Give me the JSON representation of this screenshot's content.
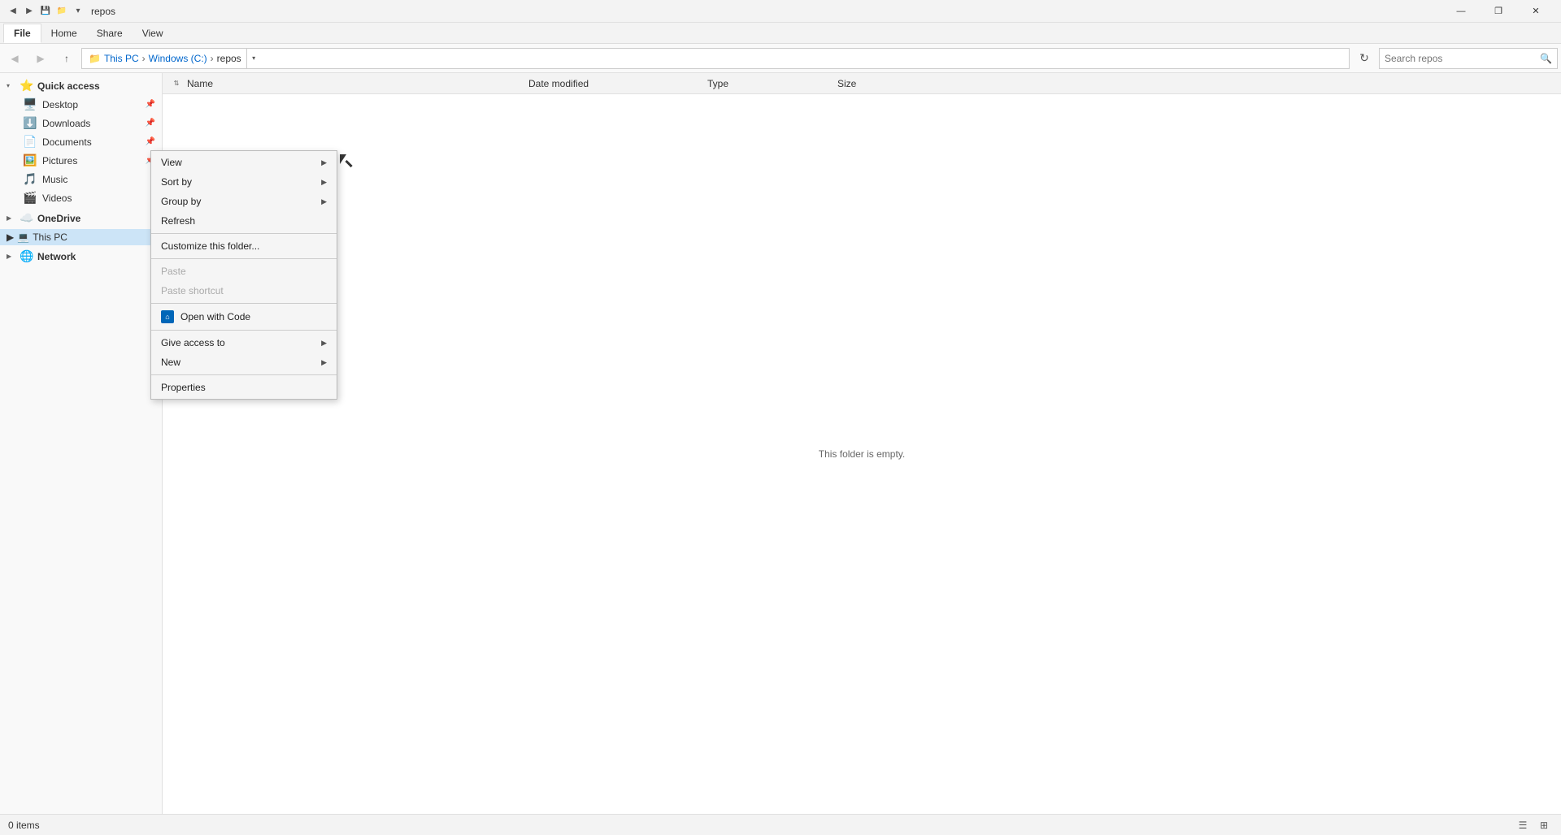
{
  "titlebar": {
    "title": "repos",
    "icons": [
      "back-icon",
      "forward-icon",
      "save-icon",
      "folder-icon"
    ],
    "minimize_label": "—",
    "restore_label": "❐",
    "close_label": "✕"
  },
  "ribbon": {
    "tabs": [
      "File",
      "Home",
      "Share",
      "View"
    ]
  },
  "addressbar": {
    "breadcrumbs": [
      "This PC",
      "Windows (C:)",
      "repos"
    ],
    "search_placeholder": "Search repos"
  },
  "sidebar": {
    "quick_access_label": "Quick access",
    "items": [
      {
        "label": "Desktop",
        "pinned": true
      },
      {
        "label": "Downloads",
        "pinned": true
      },
      {
        "label": "Documents",
        "pinned": true
      },
      {
        "label": "Pictures",
        "pinned": true
      },
      {
        "label": "Music",
        "pinned": false
      },
      {
        "label": "Videos",
        "pinned": false
      }
    ],
    "onedrive_label": "OneDrive",
    "thispc_label": "This PC",
    "network_label": "Network"
  },
  "columns": {
    "name": "Name",
    "date_modified": "Date modified",
    "type": "Type",
    "size": "Size"
  },
  "file_area": {
    "empty_message": "This folder is empty."
  },
  "context_menu": {
    "items": [
      {
        "id": "view",
        "label": "View",
        "has_arrow": true,
        "disabled": false,
        "has_icon": false
      },
      {
        "id": "sort-by",
        "label": "Sort by",
        "has_arrow": true,
        "disabled": false,
        "has_icon": false
      },
      {
        "id": "group-by",
        "label": "Group by",
        "has_arrow": true,
        "disabled": false,
        "has_icon": false
      },
      {
        "id": "refresh",
        "label": "Refresh",
        "has_arrow": false,
        "disabled": false,
        "has_icon": false
      },
      {
        "separator_after": true
      },
      {
        "id": "customize",
        "label": "Customize this folder...",
        "has_arrow": false,
        "disabled": false,
        "has_icon": false
      },
      {
        "separator_after": true
      },
      {
        "id": "paste",
        "label": "Paste",
        "has_arrow": false,
        "disabled": true,
        "has_icon": false
      },
      {
        "id": "paste-shortcut",
        "label": "Paste shortcut",
        "has_arrow": false,
        "disabled": true,
        "has_icon": false
      },
      {
        "separator_after": true
      },
      {
        "id": "open-with-code",
        "label": "Open with Code",
        "has_arrow": false,
        "disabled": false,
        "has_icon": true,
        "icon_type": "vscode"
      },
      {
        "separator_after": true
      },
      {
        "id": "give-access",
        "label": "Give access to",
        "has_arrow": true,
        "disabled": false,
        "has_icon": false
      },
      {
        "id": "new",
        "label": "New",
        "has_arrow": true,
        "disabled": false,
        "has_icon": false
      },
      {
        "separator_after": true
      },
      {
        "id": "properties",
        "label": "Properties",
        "has_arrow": false,
        "disabled": false,
        "has_icon": false
      }
    ]
  },
  "status_bar": {
    "items_count": "0 items"
  }
}
